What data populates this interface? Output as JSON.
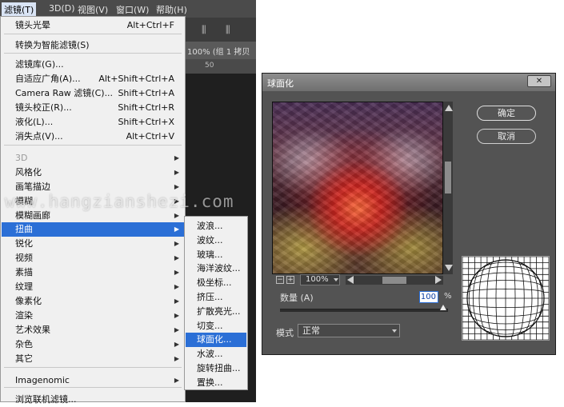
{
  "menubar": {
    "items": [
      {
        "label": "滤镜(T)",
        "active": true
      },
      {
        "label": "3D(D)",
        "active": false
      },
      {
        "label": "视图(V)",
        "active": false
      },
      {
        "label": "窗口(W)",
        "active": false
      },
      {
        "label": "帮助(H)",
        "active": false
      }
    ]
  },
  "filter_menu": {
    "items": [
      {
        "label": "镜头光晕",
        "shortcut": "Alt+Ctrl+F"
      },
      {
        "label": "转换为智能滤镜(S)",
        "shortcut": ""
      },
      {
        "label": "滤镜库(G)...",
        "shortcut": ""
      },
      {
        "label": "自适应广角(A)...",
        "shortcut": "Alt+Shift+Ctrl+A"
      },
      {
        "label": "Camera Raw 滤镜(C)...",
        "shortcut": "Shift+Ctrl+A"
      },
      {
        "label": "镜头校正(R)...",
        "shortcut": "Shift+Ctrl+R"
      },
      {
        "label": "液化(L)...",
        "shortcut": "Shift+Ctrl+X"
      },
      {
        "label": "消失点(V)...",
        "shortcut": "Alt+Ctrl+V"
      },
      {
        "label": "3D",
        "shortcut": ""
      },
      {
        "label": "风格化",
        "shortcut": ""
      },
      {
        "label": "画笔描边",
        "shortcut": ""
      },
      {
        "label": "模糊",
        "shortcut": ""
      },
      {
        "label": "模糊画廊",
        "shortcut": ""
      },
      {
        "label": "扭曲",
        "shortcut": ""
      },
      {
        "label": "锐化",
        "shortcut": ""
      },
      {
        "label": "视频",
        "shortcut": ""
      },
      {
        "label": "素描",
        "shortcut": ""
      },
      {
        "label": "纹理",
        "shortcut": ""
      },
      {
        "label": "像素化",
        "shortcut": ""
      },
      {
        "label": "渲染",
        "shortcut": ""
      },
      {
        "label": "艺术效果",
        "shortcut": ""
      },
      {
        "label": "杂色",
        "shortcut": ""
      },
      {
        "label": "其它",
        "shortcut": ""
      },
      {
        "label": "Imagenomic",
        "shortcut": ""
      },
      {
        "label": "浏览联机滤镜...",
        "shortcut": ""
      }
    ]
  },
  "distort_submenu": {
    "items": [
      "波浪...",
      "波纹...",
      "玻璃...",
      "海洋波纹...",
      "极坐标...",
      "挤压...",
      "扩散亮光...",
      "切变...",
      "球面化...",
      "水波...",
      "旋转扭曲...",
      "置换..."
    ]
  },
  "background": {
    "tab_text": "100% (组 1 拷贝",
    "ruler_text": "50"
  },
  "watermark": "www.hangzianshezi.com",
  "dialog": {
    "title": "球面化",
    "close_label": "✕",
    "ok_label": "确定",
    "cancel_label": "取消",
    "zoom_minus": "−",
    "zoom_plus": "+",
    "zoom_level": "100%",
    "amount_label": "数量 (A)",
    "amount_value": "100",
    "amount_unit": "%",
    "mode_label": "模式",
    "mode_value": "正常"
  },
  "colors": {
    "highlight": "#2b6fd6",
    "dialog_bg": "#535353"
  }
}
